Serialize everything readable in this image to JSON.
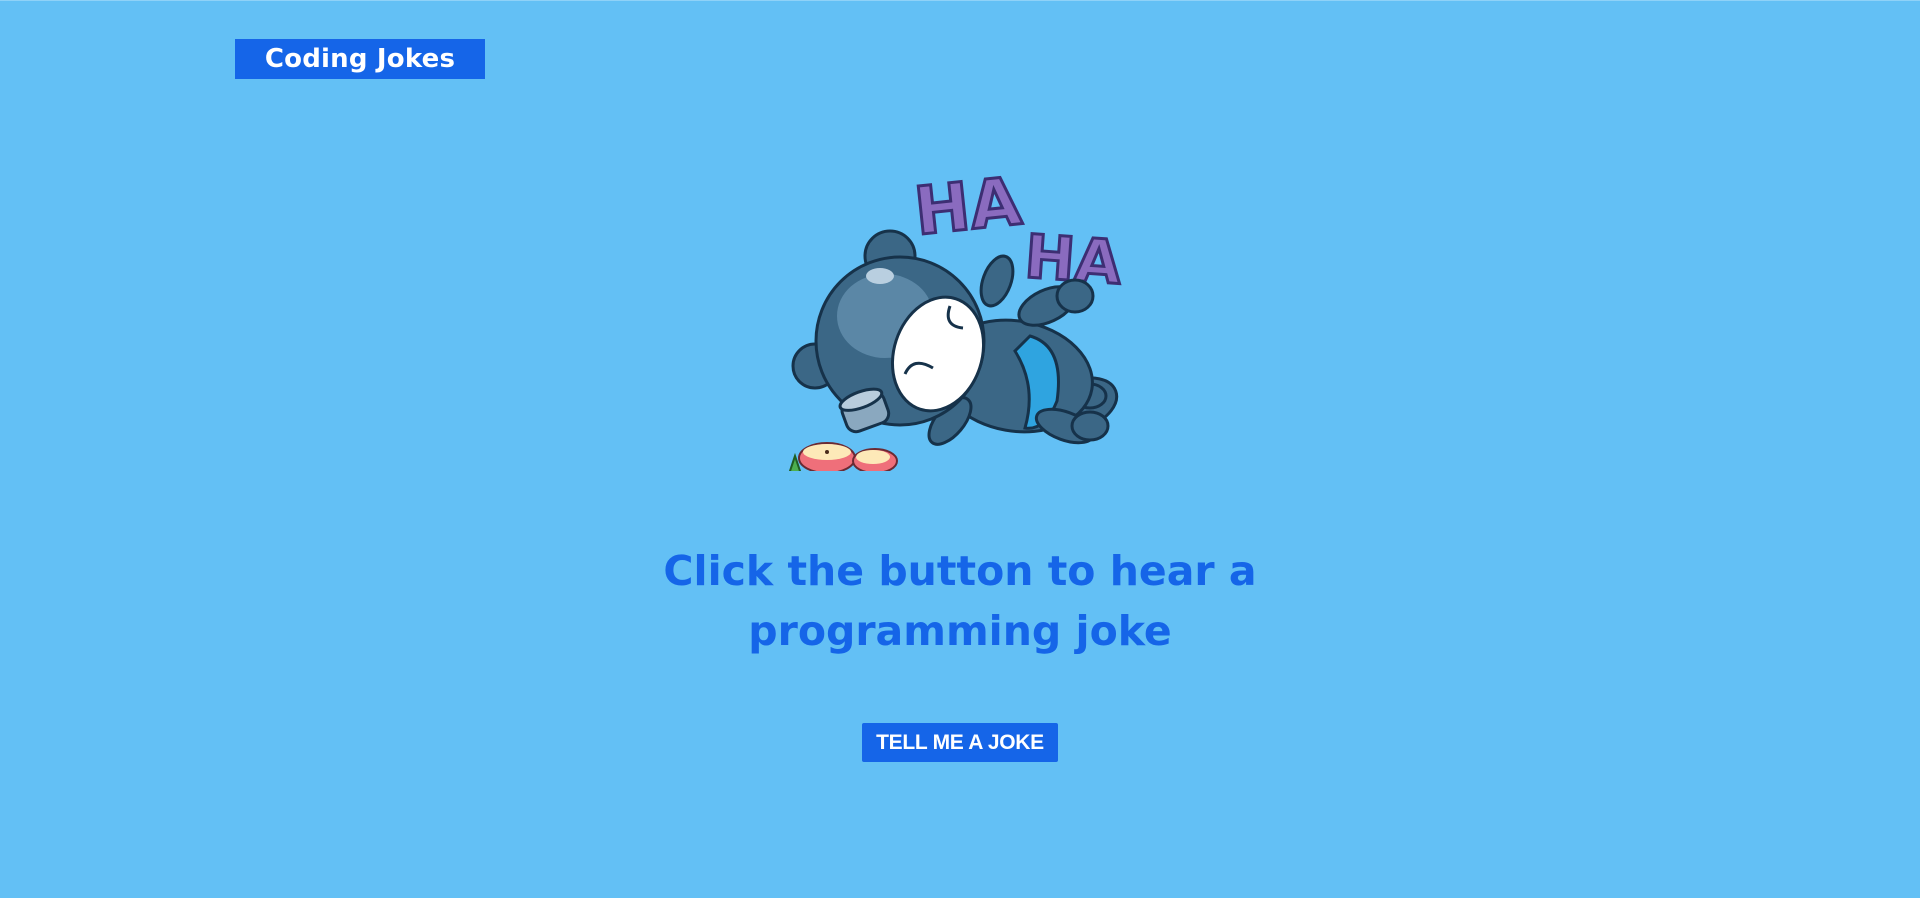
{
  "header": {
    "brand_label": "Coding Jokes",
    "brand_color": "#1565e8"
  },
  "main": {
    "illustration_icon": "laughing-ninja-bear-icon",
    "illustration_text_1": "HA",
    "illustration_text_2": "HA",
    "headline": "Click the button to hear a programming joke",
    "button_label": "TELL ME A JOKE"
  },
  "colors": {
    "background": "#63c0f5",
    "accent": "#1565e8",
    "text_on_accent": "#ffffff",
    "haha_letters": "#8a6bbf"
  }
}
